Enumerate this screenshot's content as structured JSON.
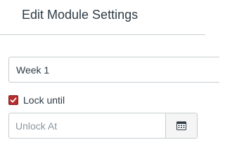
{
  "dialog": {
    "title": "Edit Module Settings"
  },
  "module_name": {
    "value": "Week 1"
  },
  "lock": {
    "label": "Lock until",
    "checked": true
  },
  "unlock_date": {
    "value": "",
    "placeholder": "Unlock At",
    "button_icon": "calendar-icon"
  },
  "colors": {
    "checkbox_fill": "#b52c2c",
    "border": "#c7cdd1",
    "text": "#2d3b45"
  }
}
